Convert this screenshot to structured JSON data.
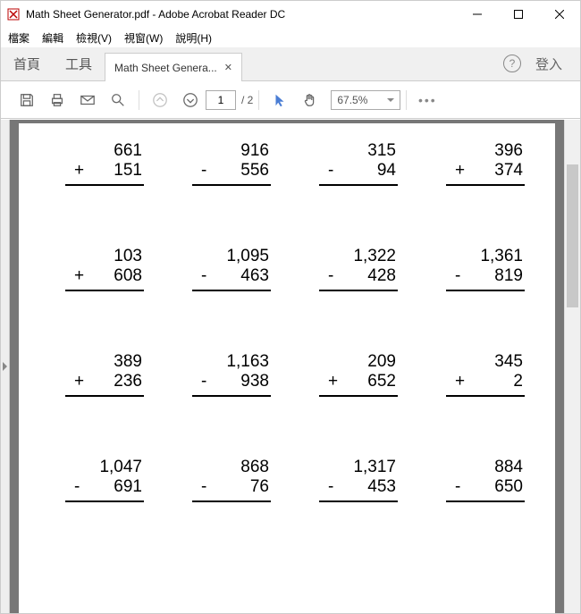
{
  "window": {
    "title": "Math Sheet Generator.pdf - Adobe Acrobat Reader DC"
  },
  "menubar": [
    "檔案",
    "編輯",
    "檢視(V)",
    "視窗(W)",
    "說明(H)"
  ],
  "tabs": {
    "home": "首頁",
    "tools": "工具",
    "doc": "Math Sheet Genera...",
    "login": "登入"
  },
  "toolbar": {
    "page_current": "1",
    "page_total": "/ 2",
    "zoom": "67.5%"
  },
  "problems": [
    {
      "top": "661",
      "op": "+",
      "bot": "151"
    },
    {
      "top": "916",
      "op": "-",
      "bot": "556"
    },
    {
      "top": "315",
      "op": "-",
      "bot": "94"
    },
    {
      "top": "396",
      "op": "+",
      "bot": "374"
    },
    {
      "top": "103",
      "op": "+",
      "bot": "608"
    },
    {
      "top": "1,095",
      "op": "-",
      "bot": "463"
    },
    {
      "top": "1,322",
      "op": "-",
      "bot": "428"
    },
    {
      "top": "1,361",
      "op": "-",
      "bot": "819"
    },
    {
      "top": "389",
      "op": "+",
      "bot": "236"
    },
    {
      "top": "1,163",
      "op": "-",
      "bot": "938"
    },
    {
      "top": "209",
      "op": "+",
      "bot": "652"
    },
    {
      "top": "345",
      "op": "+",
      "bot": "2"
    },
    {
      "top": "1,047",
      "op": "-",
      "bot": "691"
    },
    {
      "top": "868",
      "op": "-",
      "bot": "76"
    },
    {
      "top": "1,317",
      "op": "-",
      "bot": "453"
    },
    {
      "top": "884",
      "op": "-",
      "bot": "650"
    }
  ]
}
